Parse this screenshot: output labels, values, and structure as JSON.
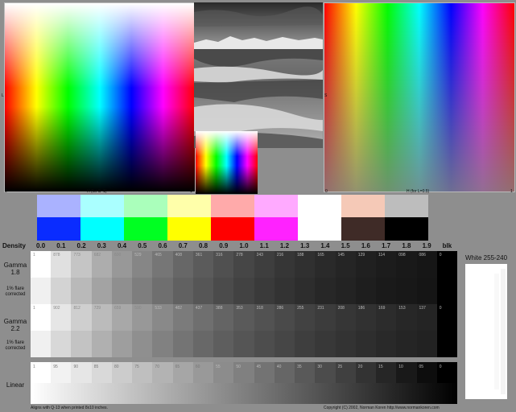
{
  "hue_map": {
    "left_axis": "L",
    "bottom_left": "0",
    "bottom_caption": "H  (for S=1)",
    "bottom_right": "1"
  },
  "sat_map": {
    "left_axis": "S",
    "bottom_left": "0",
    "bottom_caption": "H  (for L=0.5)",
    "bottom_right": "1"
  },
  "patches_top": [
    "#aab2ff",
    "#aaffff",
    "#aaffbb",
    "#ffffaa",
    "#ffaaaa",
    "#ffaaff",
    "#ffffff",
    "#f5c9b7",
    "#bdbdbd"
  ],
  "patches_bottom": [
    "#0a2cff",
    "#00ffff",
    "#00ff22",
    "#ffff00",
    "#ff0000",
    "#ff22ff",
    "#ffffff",
    "#3f2b27",
    "#000000"
  ],
  "density": {
    "title": "Density",
    "values": [
      "0.0",
      "0.1",
      "0.2",
      "0.3",
      "0.4",
      "0.5",
      "0.6",
      "0.7",
      "0.8",
      "0.9",
      "1.0",
      "1.1",
      "1.2",
      "1.3",
      "1.4",
      "1.5",
      "1.6",
      "1.7",
      "1.8",
      "1.9",
      "blk"
    ]
  },
  "gamma18": {
    "label_line1": "Gamma",
    "label_line2": "1.8",
    "flare_line1": "1% flare",
    "flare_line2": "corrected",
    "numbers": [
      "1",
      "878",
      "773",
      "682",
      "600",
      "529",
      "465",
      "408",
      "361",
      "316",
      "278",
      "243",
      "216",
      "188",
      "165",
      "145",
      "129",
      "114",
      "098",
      "086",
      "0"
    ]
  },
  "gamma22": {
    "label_line1": "Gamma",
    "label_line2": "2.2",
    "flare_line1": "1% flare",
    "flare_line2": "corrected",
    "numbers": [
      "1",
      "902",
      "812",
      "729",
      "659",
      "590",
      "533",
      "482",
      "437",
      "388",
      "353",
      "318",
      "286",
      "255",
      "231",
      "208",
      "186",
      "169",
      "153",
      "137",
      "0"
    ]
  },
  "linear": {
    "label": "Linear",
    "numbers": [
      "1",
      "95",
      "90",
      "85",
      "80",
      "75",
      "70",
      "65",
      "60",
      "55",
      "50",
      "45",
      "40",
      "35",
      "30",
      "25",
      "20",
      "15",
      "10",
      "05",
      "0"
    ]
  },
  "white_box": {
    "label": "White 255-240"
  },
  "footer": {
    "left": "Aligns with Q-13 when printed 8x10 inches.",
    "right": "Copyright (C) 2002, Norman Koren   http://www.normankoren.com"
  }
}
